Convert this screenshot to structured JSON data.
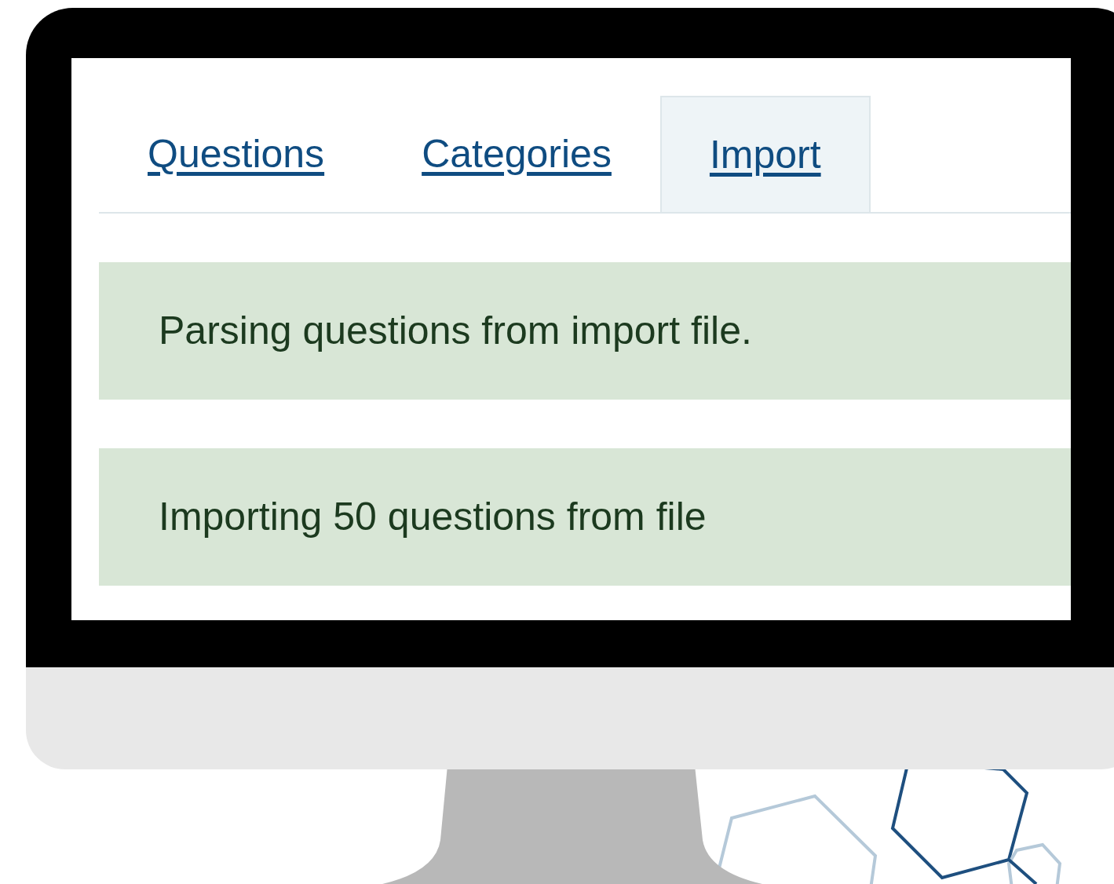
{
  "tabs": [
    {
      "label": "Questions",
      "selected": false
    },
    {
      "label": "Categories",
      "selected": false
    },
    {
      "label": "Import",
      "selected": true
    }
  ],
  "alerts": [
    {
      "text": "Parsing questions from import file."
    },
    {
      "text": "Importing 50 questions from file"
    }
  ]
}
